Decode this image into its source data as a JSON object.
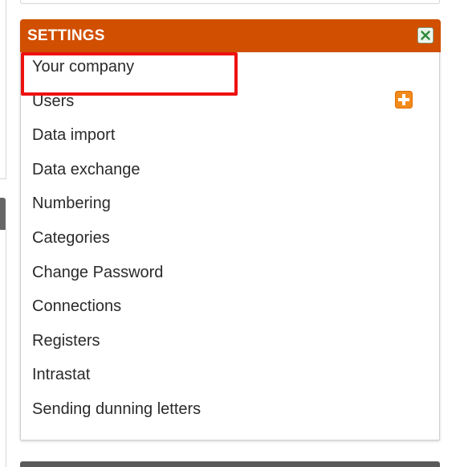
{
  "panel": {
    "title": "SETTINGS",
    "header_color": "#d14f00",
    "close_icon": "close-x-icon",
    "add_icon": "plus-icon"
  },
  "menu": {
    "items": [
      {
        "label": "Your company"
      },
      {
        "label": "Users"
      },
      {
        "label": "Data import"
      },
      {
        "label": "Data exchange"
      },
      {
        "label": "Numbering"
      },
      {
        "label": "Categories"
      },
      {
        "label": "Change Password"
      },
      {
        "label": "Connections"
      },
      {
        "label": "Registers"
      },
      {
        "label": "Intrastat"
      },
      {
        "label": "Sending dunning letters"
      }
    ]
  },
  "highlight": {
    "target": "Your company",
    "color": "#ee1111"
  }
}
